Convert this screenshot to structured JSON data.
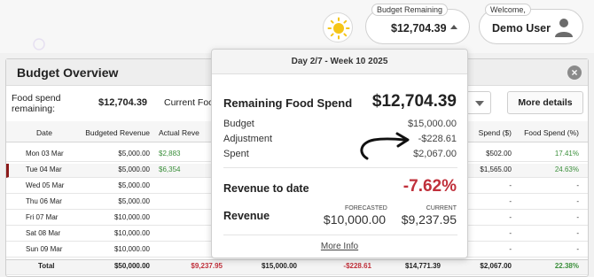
{
  "header": {
    "budget_remaining_label": "Budget Remaining",
    "budget_remaining_value": "$12,704.39",
    "welcome_label": "Welcome,",
    "user_name": "Demo User"
  },
  "panel": {
    "title": "Budget Overview",
    "food_spend_label": "Food spend remaining:",
    "food_spend_value": "$12,704.39",
    "current_label": "Current Food",
    "more_details_label": "More details"
  },
  "table": {
    "headers": {
      "date": "Date",
      "budgeted_revenue": "Budgeted Revenue",
      "actual_revenue": "Actual Reve",
      "food_spend": "Spend ($)",
      "food_spend_pct": "Food  Spend (%)"
    },
    "rows": [
      {
        "date": "Mon 03 Mar",
        "budgeted": "$5,000.00",
        "actual": "$2,883",
        "spend": "$502.00",
        "pct": "17.41%"
      },
      {
        "date": "Tue 04 Mar",
        "budgeted": "$5,000.00",
        "actual": "$6,354",
        "spend": "$1,565.00",
        "pct": "24.63%"
      },
      {
        "date": "Wed 05 Mar",
        "budgeted": "$5,000.00",
        "actual": "",
        "spend": "-",
        "pct": "-"
      },
      {
        "date": "Thu 06 Mar",
        "budgeted": "$5,000.00",
        "actual": "",
        "spend": "-",
        "pct": "-"
      },
      {
        "date": "Fri 07 Mar",
        "budgeted": "$10,000.00",
        "actual": "",
        "spend": "-",
        "pct": "-"
      },
      {
        "date": "Sat 08 Mar",
        "budgeted": "$10,000.00",
        "actual": "",
        "spend": "-",
        "pct": "-"
      },
      {
        "date": "Sun 09 Mar",
        "budgeted": "$10,000.00",
        "actual": "",
        "spend": "-",
        "pct": "-"
      }
    ],
    "total": {
      "label": "Total",
      "budgeted": "$50,000.00",
      "actual": "$9,237.95",
      "budget": "$15,000.00",
      "adjustment": "-$228.61",
      "remaining": "$14,771.39",
      "spend": "$2,067.00",
      "pct": "22.38%"
    }
  },
  "popover": {
    "header": "Day 2/7 - Week 10 2025",
    "remaining_label": "Remaining Food Spend",
    "remaining_value": "$12,704.39",
    "budget_label": "Budget",
    "budget_value": "$15,000.00",
    "adjustment_label": "Adjustment",
    "adjustment_value": "-$228.61",
    "spent_label": "Spent",
    "spent_value": "$2,067.00",
    "revenue_to_date_label": "Revenue to date",
    "revenue_to_date_value": "-7.62%",
    "revenue_label": "Revenue",
    "forecasted_label": "FORECASTED",
    "forecasted_value": "$10,000.00",
    "current_label": "CURRENT",
    "current_value": "$9,237.95",
    "more_info_label": "More Info"
  },
  "colors": {
    "negative": "#c0303b",
    "positive": "#3b8f3b",
    "sun": "#f5c518"
  },
  "icons": [
    "sun-icon",
    "caret-up-icon",
    "user-icon",
    "close-icon",
    "chevron-down-icon",
    "arrow-annotation-icon"
  ]
}
